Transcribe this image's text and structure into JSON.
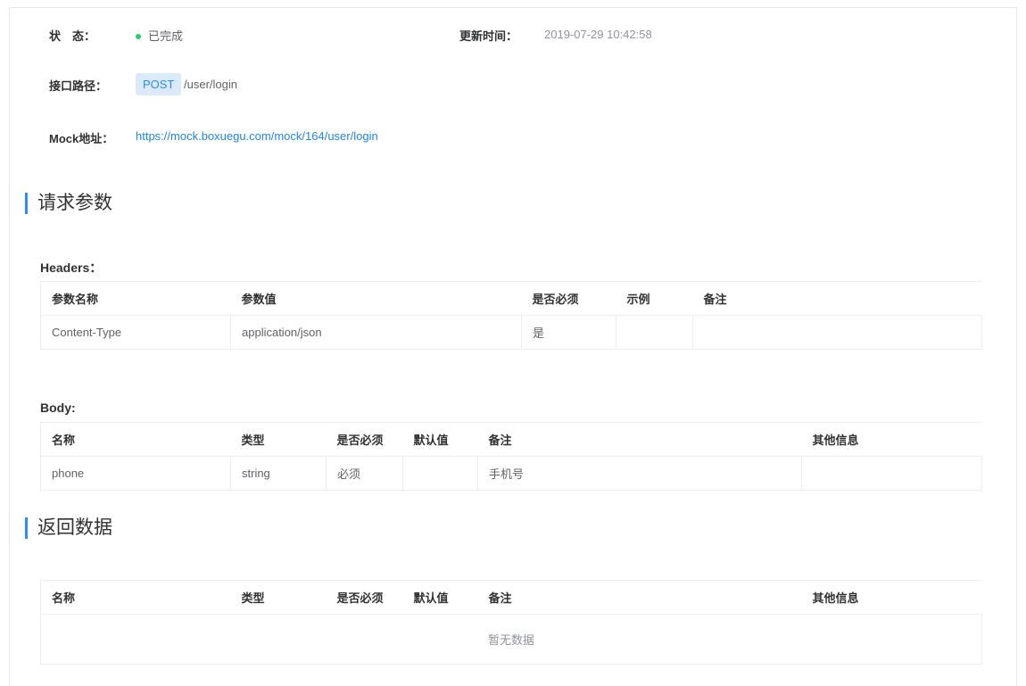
{
  "info": {
    "status_label": "状　态：",
    "status_value": "已完成",
    "updated_label": "更新时间：",
    "updated_value": "2019-07-29 10:42:58",
    "path_label": "接口路径：",
    "method": "POST",
    "path": "/user/login",
    "mock_label": "Mock地址：",
    "mock_url": "https://mock.boxuegu.com/mock/164/user/login"
  },
  "request": {
    "title": "请求参数",
    "headers_title": "Headers：",
    "headers_columns": [
      "参数名称",
      "参数值",
      "是否必须",
      "示例",
      "备注"
    ],
    "headers_rows": [
      [
        "Content-Type",
        "application/json",
        "是",
        "",
        ""
      ]
    ],
    "body_title": "Body:",
    "body_columns": [
      "名称",
      "类型",
      "是否必须",
      "默认值",
      "备注",
      "其他信息"
    ],
    "body_rows": [
      [
        "phone",
        "string",
        "必须",
        "",
        "手机号",
        ""
      ]
    ]
  },
  "response": {
    "title": "返回数据",
    "columns": [
      "名称",
      "类型",
      "是否必须",
      "默认值",
      "备注",
      "其他信息"
    ],
    "empty_text": "暂无数据"
  },
  "colors": {
    "accent": "#2d8cf0",
    "status_dot": "#2ecc71",
    "link": "#1d86e8"
  }
}
